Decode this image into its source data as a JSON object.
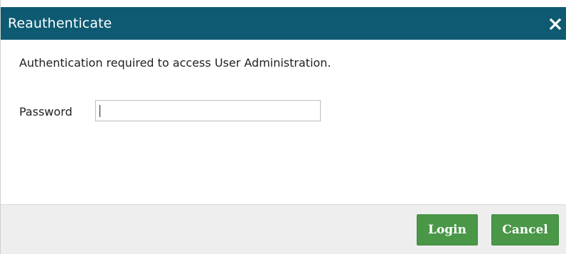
{
  "dialog": {
    "title": "Reauthenticate",
    "close_icon": "close-icon",
    "message": "Authentication required to access User Administration.",
    "password_label": "Password",
    "password_value": "",
    "password_placeholder": "",
    "buttons": {
      "login_label": "Login",
      "cancel_label": "Cancel"
    }
  },
  "colors": {
    "titlebar": "#0e5a73",
    "button": "#4a9748",
    "footer": "#eeeeee"
  }
}
